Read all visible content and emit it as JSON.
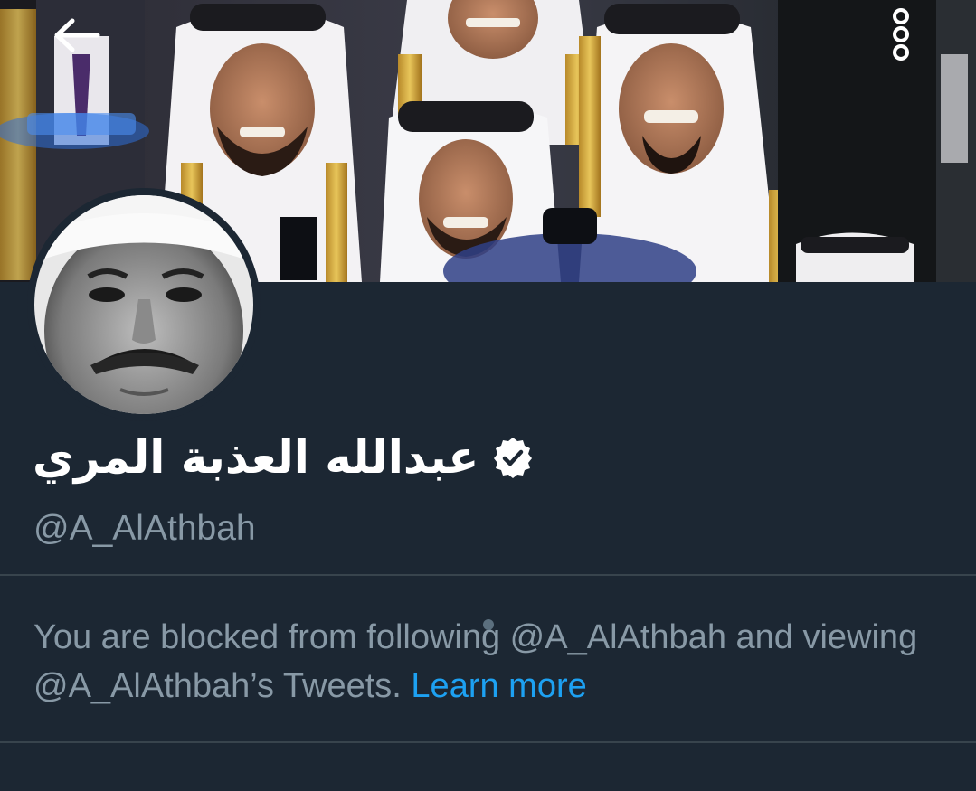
{
  "header": {
    "back_icon": "arrow-left-icon",
    "more_icon": "vertical-dots-icon"
  },
  "profile": {
    "display_name": "عبدالله العذبة المري",
    "verified_icon": "verified-badge-icon",
    "handle": "@A_AlAthbah"
  },
  "notice": {
    "text": "You are blocked from following @A_AlAthbah and viewing @A_AlAthbah’s Tweets.",
    "link_label": "Learn more"
  },
  "colors": {
    "background": "#1c2733",
    "divider": "#38444d",
    "secondary_text": "#8899a6",
    "link": "#1da1f2",
    "primary_text": "#ffffff"
  }
}
